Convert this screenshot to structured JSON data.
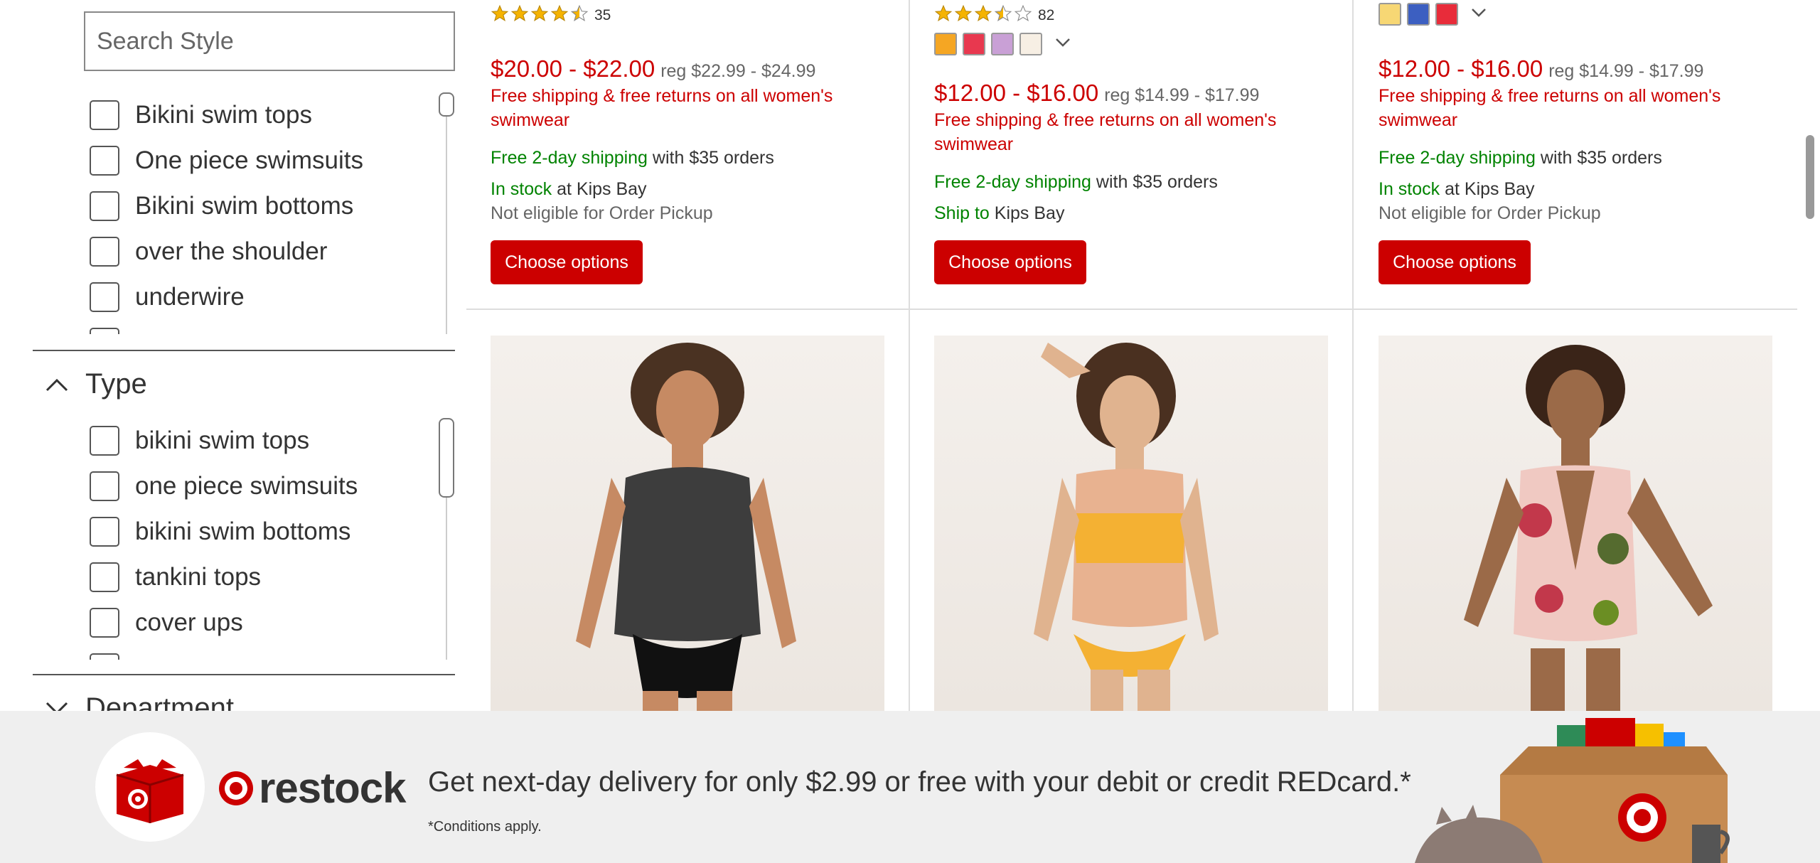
{
  "sidebar": {
    "search_placeholder": "Search Style",
    "style_options": [
      "Bikini swim tops",
      "One piece swimsuits",
      "Bikini swim bottoms",
      "over the shoulder",
      "underwire"
    ],
    "type_section": {
      "title": "Type",
      "options": [
        "bikini swim tops",
        "one piece swimsuits",
        "bikini swim bottoms",
        "tankini tops",
        "cover ups"
      ]
    },
    "department_section": {
      "title": "Department"
    }
  },
  "products": [
    {
      "rating": 4.5,
      "rating_count": "35",
      "swatches": [],
      "price": "$20.00 - $22.00",
      "reg_price": "reg $22.99 - $24.99",
      "promo": "Free shipping & free returns on all women's swimwear",
      "shipping_green": "Free 2-day shipping",
      "shipping_rest": "with $35 orders",
      "availability_green": "In stock",
      "availability_rest": "at Kips Bay",
      "pickup": "Not eligible for Order Pickup",
      "button": "Choose options"
    },
    {
      "rating": 3.5,
      "rating_count": "82",
      "swatches": [
        "#f5a623",
        "#e8384f",
        "#c9a0d6",
        "#f7efe4"
      ],
      "price": "$12.00 - $16.00",
      "reg_price": "reg $14.99 - $17.99",
      "promo": "Free shipping & free returns on all women's swimwear",
      "shipping_green": "Free 2-day shipping",
      "shipping_rest": "with $35 orders",
      "availability_green": "Ship to",
      "availability_rest": "Kips Bay",
      "pickup": "",
      "button": "Choose options"
    },
    {
      "rating": null,
      "rating_count": "",
      "swatches": [
        "#f7d774",
        "#3c5fc1",
        "#e82c3a"
      ],
      "price": "$12.00 - $16.00",
      "reg_price": "reg $14.99 - $17.99",
      "promo": "Free shipping & free returns on all women's swimwear",
      "shipping_green": "Free 2-day shipping",
      "shipping_rest": "with $35 orders",
      "availability_green": "In stock",
      "availability_rest": "at Kips Bay",
      "pickup": "Not eligible for Order Pickup",
      "button": "Choose options"
    }
  ],
  "banner": {
    "logo_text": "restock",
    "headline": "Get next-day delivery for only $2.99 or free with your debit or credit REDcard.*",
    "fine_print": "*Conditions apply."
  },
  "colors": {
    "target_red": "#cc0000",
    "green": "#008300"
  }
}
